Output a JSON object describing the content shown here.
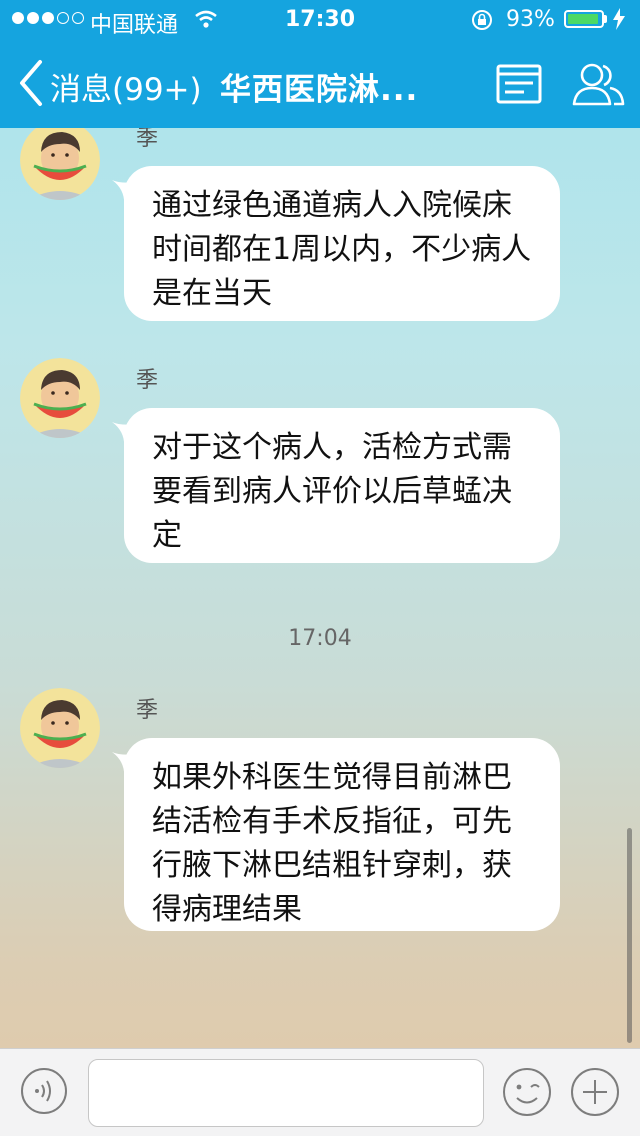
{
  "status_bar": {
    "carrier": "中国联通",
    "time": "17:30",
    "battery_percent": "93%",
    "battery_level": 0.93
  },
  "navbar": {
    "back_label": "消息(99+)",
    "title": "华西医院淋..."
  },
  "messages": [
    {
      "sender": "季",
      "text": "通过绿色通道病人入院候床时间都在1周以内，不少病人是在当天"
    },
    {
      "sender": "季",
      "text": "对于这个病人，活检方式需要看到病人评价以后草蜢决定"
    },
    {
      "sender": "季",
      "text": "如果外科医生觉得目前淋巴结活检有手术反指征，可先行腋下淋巴结粗针穿刺，获得病理结果"
    }
  ],
  "time_separator": "17:04",
  "input": {
    "value": "",
    "placeholder": ""
  },
  "colors": {
    "nav_bg": "#15a4df",
    "bubble_bg": "#ffffff"
  }
}
